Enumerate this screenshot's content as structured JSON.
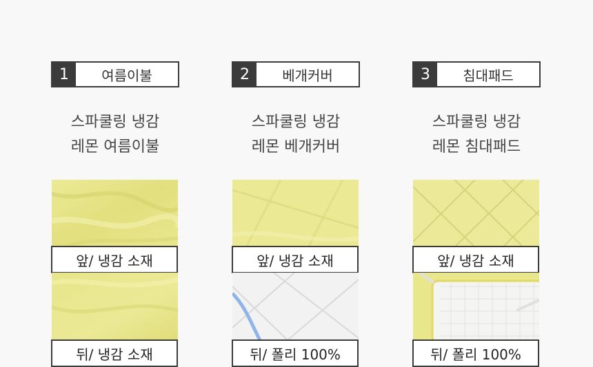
{
  "items": [
    {
      "number": "1",
      "name": "여름이불",
      "desc_line1": "스파쿨링 냉감",
      "desc_line2": "레몬 여름이불",
      "front_label": "앞/ 냉감 소재",
      "back_label": "뒤/ 냉감 소재"
    },
    {
      "number": "2",
      "name": "베개커버",
      "desc_line1": "스파쿨링 냉감",
      "desc_line2": "레몬 베개커버",
      "front_label": "앞/ 냉감 소재",
      "back_label": "뒤/ 폴리 100%"
    },
    {
      "number": "3",
      "name": "침대패드",
      "desc_line1": "스파쿨링 냉감",
      "desc_line2": "레몬 침대패드",
      "front_label": "앞/ 냉감 소재",
      "back_label": "뒤/ 폴리 100%"
    }
  ],
  "colors": {
    "lemon": "#e6e48a",
    "lemon_light": "#efed9c",
    "white_quilt": "#f3f3f3",
    "accent_blue": "#8fb4e6",
    "dark": "#3b3b3b"
  }
}
